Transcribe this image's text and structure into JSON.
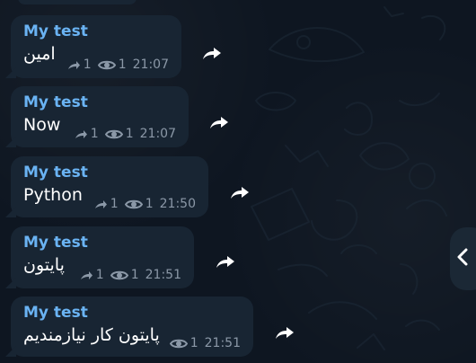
{
  "chat": {
    "messages": [
      {
        "sender": "My test",
        "text": "امين",
        "forward_count": "1",
        "views": "1",
        "time": "21:07"
      },
      {
        "sender": "My test",
        "text": "Now",
        "forward_count": "1",
        "views": "1",
        "time": "21:07"
      },
      {
        "sender": "My test",
        "text": "Python",
        "forward_count": "1",
        "views": "1",
        "time": "21:50"
      },
      {
        "sender": "My test",
        "text": "پایتون",
        "forward_count": "1",
        "views": "1",
        "time": "21:51"
      },
      {
        "sender": "My test",
        "text": "پایتون کار نیازمندیم",
        "views": "1",
        "time": "21:51"
      }
    ]
  },
  "icons": {
    "forward": "forward-icon",
    "view": "eye-icon",
    "forwarded": "share-icon",
    "collapse": "chevron-left-icon"
  },
  "colors": {
    "background": "#0e1621",
    "bubble": "#182533",
    "sender": "#6ab3f3",
    "meta": "#8b98a7",
    "text": "#ffffff"
  }
}
